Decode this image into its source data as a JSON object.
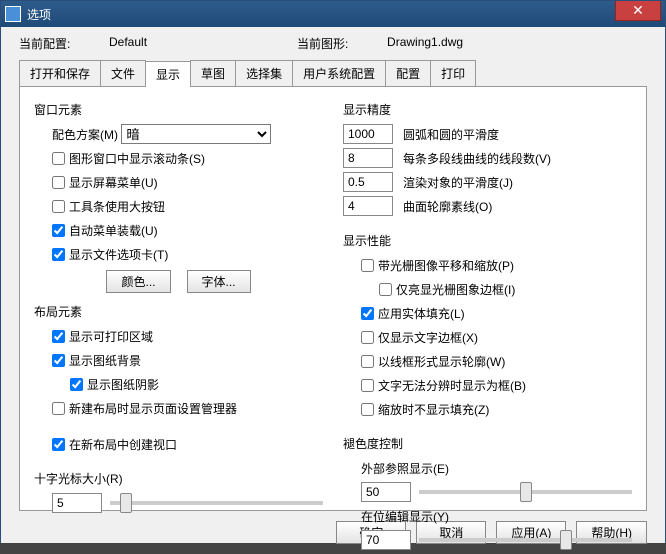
{
  "window": {
    "title": "选项"
  },
  "config": {
    "current_config_label": "当前配置:",
    "current_config_value": "Default",
    "current_drawing_label": "当前图形:",
    "current_drawing_value": "Drawing1.dwg"
  },
  "tabs": [
    "打开和保存",
    "文件",
    "显示",
    "草图",
    "选择集",
    "用户系统配置",
    "配置",
    "打印"
  ],
  "active_tab": 2,
  "left": {
    "group1_title": "窗口元素",
    "scheme_label": "配色方案(M)",
    "scheme_value": "暗",
    "cb_scroll": "图形窗口中显示滚动条(S)",
    "cb_screen_menu": "显示屏幕菜单(U)",
    "cb_large_btn": "工具条使用大按钮",
    "cb_auto_menu": "自动菜单装载(U)",
    "cb_file_tab": "显示文件选项卡(T)",
    "btn_color": "颜色...",
    "btn_font": "字体...",
    "group2_title": "布局元素",
    "cb_print_area": "显示可打印区域",
    "cb_paper_bg": "显示图纸背景",
    "cb_paper_shadow": "显示图纸阴影",
    "cb_new_layout_mgr": "新建布局时显示页面设置管理器",
    "cb_create_vp": "在新布局中创建视口",
    "group3_title": "十字光标大小(R)",
    "cross_size": "5"
  },
  "right": {
    "group1_title": "显示精度",
    "prec": [
      {
        "v": "1000",
        "l": "圆弧和圆的平滑度"
      },
      {
        "v": "8",
        "l": "每条多段线曲线的线段数(V)"
      },
      {
        "v": "0.5",
        "l": "渲染对象的平滑度(J)"
      },
      {
        "v": "4",
        "l": "曲面轮廓素线(O)"
      }
    ],
    "group2_title": "显示性能",
    "cb_pan_raster": "带光栅图像平移和缩放(P)",
    "cb_hilite_raster": "仅亮显光栅图象边框(I)",
    "cb_solid_fill": "应用实体填充(L)",
    "cb_text_bdry": "仅显示文字边框(X)",
    "cb_wire_silh": "以线框形式显示轮廓(W)",
    "cb_text_box": "文字无法分辨时显示为框(B)",
    "cb_no_fill_zoom": "缩放时不显示填充(Z)",
    "group3_title": "褪色度控制",
    "xref_label": "外部参照显示(E)",
    "xref_value": "50",
    "inplace_label": "在位编辑显示(Y)",
    "inplace_value": "70"
  },
  "footer": {
    "ok": "确定",
    "cancel": "取消",
    "apply": "应用(A)",
    "help": "帮助(H)"
  }
}
